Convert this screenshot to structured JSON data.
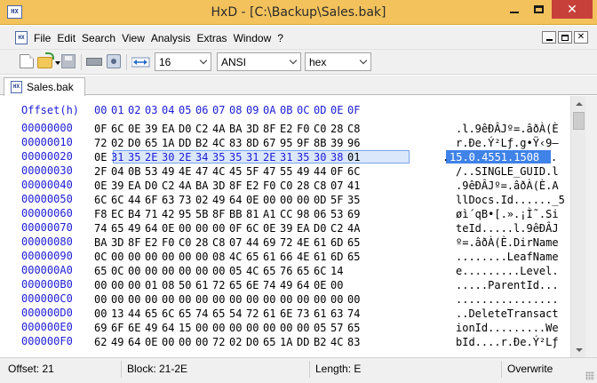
{
  "window": {
    "title": "HxD - [C:\\Backup\\Sales.bak]",
    "app_icon_text": "HX",
    "minimize_icon": "minimize-icon",
    "maximize_icon": "maximize-icon",
    "close_icon": "close-icon",
    "close_glyph": "✕",
    "accent_color": "#f3c25c",
    "close_color": "#c7403a"
  },
  "menu": {
    "doc_icon_text": "HX",
    "items": [
      "File",
      "Edit",
      "Search",
      "View",
      "Analysis",
      "Extras",
      "Window",
      "?"
    ],
    "mdi_close_glyph": "✕"
  },
  "toolbar": {
    "icons": [
      "new-file-icon",
      "open-folder-icon",
      "save-icon",
      "open-ram-icon",
      "open-disk-icon",
      "bytes-per-row-icon"
    ],
    "bytes_per_row_arrow": "↔",
    "bytes_per_row": "16",
    "charset": "ANSI",
    "offset_base": "hex"
  },
  "tab": {
    "icon_text": "HX",
    "label": "Sales.bak"
  },
  "editor": {
    "header_label": "Offset(h)",
    "columns": [
      "00",
      "01",
      "02",
      "03",
      "04",
      "05",
      "06",
      "07",
      "08",
      "09",
      "0A",
      "0B",
      "0C",
      "0D",
      "0E",
      "0F"
    ],
    "offset_color": "#1c1cd6",
    "selection": {
      "start_offset": "00000021",
      "end_offset": "0000002E",
      "text": "15.0.4551.1508",
      "highlight_color": "#3f82e8"
    },
    "rows": [
      {
        "offset": "00000000",
        "bytes": [
          "0F",
          "6C",
          "0E",
          "39",
          "EA",
          "D0",
          "C2",
          "4A",
          "BA",
          "3D",
          "8F",
          "E2",
          "F0",
          "C0",
          "28",
          "C8"
        ],
        "text": ".l.9êÐÂJº=.âðÀ(È"
      },
      {
        "offset": "00000010",
        "bytes": [
          "72",
          "02",
          "D0",
          "65",
          "1A",
          "DD",
          "B2",
          "4C",
          "83",
          "8D",
          "67",
          "95",
          "9F",
          "8B",
          "39",
          "96"
        ],
        "text": "r.Ðe.Ý²Lƒ.g•Ÿ‹9–"
      },
      {
        "offset": "00000020",
        "bytes": [
          "0E",
          "31",
          "35",
          "2E",
          "30",
          "2E",
          "34",
          "35",
          "35",
          "31",
          "2E",
          "31",
          "35",
          "30",
          "38",
          "01"
        ],
        "text_head": ".",
        "text_sel": "15.0.4551.1508",
        "text_tail": "."
      },
      {
        "offset": "00000030",
        "bytes": [
          "2F",
          "04",
          "0B",
          "53",
          "49",
          "4E",
          "47",
          "4C",
          "45",
          "5F",
          "47",
          "55",
          "49",
          "44",
          "0F",
          "6C"
        ],
        "text": "/..SINGLE_GUID.l"
      },
      {
        "offset": "00000040",
        "bytes": [
          "0E",
          "39",
          "EA",
          "D0",
          "C2",
          "4A",
          "BA",
          "3D",
          "8F",
          "E2",
          "F0",
          "C0",
          "28",
          "C8",
          "07",
          "41"
        ],
        "text": ".9êÐÂJº=.âðÀ(È.A"
      },
      {
        "offset": "00000050",
        "bytes": [
          "6C",
          "6C",
          "44",
          "6F",
          "63",
          "73",
          "02",
          "49",
          "64",
          "0E",
          "00",
          "00",
          "00",
          "0D",
          "5F",
          "35"
        ],
        "text": "llDocs.Id......_5"
      },
      {
        "offset": "00000060",
        "bytes": [
          "F8",
          "EC",
          "B4",
          "71",
          "42",
          "95",
          "5B",
          "8F",
          "BB",
          "81",
          "A1",
          "CC",
          "98",
          "06",
          "53",
          "69"
        ],
        "text": "øì´qB•[.».¡Ì˜.Si"
      },
      {
        "offset": "00000070",
        "bytes": [
          "74",
          "65",
          "49",
          "64",
          "0E",
          "00",
          "00",
          "00",
          "0F",
          "6C",
          "0E",
          "39",
          "EA",
          "D0",
          "C2",
          "4A"
        ],
        "text": "teId.....l.9êÐÂJ"
      },
      {
        "offset": "00000080",
        "bytes": [
          "BA",
          "3D",
          "8F",
          "E2",
          "F0",
          "C0",
          "28",
          "C8",
          "07",
          "44",
          "69",
          "72",
          "4E",
          "61",
          "6D",
          "65"
        ],
        "text": "º=.âðÀ(È.DirName"
      },
      {
        "offset": "00000090",
        "bytes": [
          "0C",
          "00",
          "00",
          "00",
          "00",
          "00",
          "00",
          "08",
          "4C",
          "65",
          "61",
          "66",
          "4E",
          "61",
          "6D",
          "65"
        ],
        "text": "........LeafName"
      },
      {
        "offset": "000000A0",
        "bytes": [
          "65",
          "0C",
          "00",
          "00",
          "00",
          "00",
          "00",
          "00",
          "05",
          "4C",
          "65",
          "76",
          "65",
          "6C",
          "14"
        ],
        "text": "e.........Level."
      },
      {
        "offset": "000000B0",
        "bytes": [
          "00",
          "00",
          "00",
          "01",
          "08",
          "50",
          "61",
          "72",
          "65",
          "6E",
          "74",
          "49",
          "64",
          "0E",
          "00"
        ],
        "text": ".....ParentId..."
      },
      {
        "offset": "000000C0",
        "bytes": [
          "00",
          "00",
          "00",
          "00",
          "00",
          "00",
          "00",
          "00",
          "00",
          "00",
          "00",
          "00",
          "00",
          "00",
          "00",
          "00"
        ],
        "text": "................"
      },
      {
        "offset": "000000D0",
        "bytes": [
          "00",
          "13",
          "44",
          "65",
          "6C",
          "65",
          "74",
          "65",
          "54",
          "72",
          "61",
          "6E",
          "73",
          "61",
          "63",
          "74"
        ],
        "text": "..DeleteTransact"
      },
      {
        "offset": "000000E0",
        "bytes": [
          "69",
          "6F",
          "6E",
          "49",
          "64",
          "15",
          "00",
          "00",
          "00",
          "00",
          "00",
          "00",
          "00",
          "05",
          "57",
          "65"
        ],
        "text": "ionId.........We"
      },
      {
        "offset": "000000F0",
        "bytes": [
          "62",
          "49",
          "64",
          "0E",
          "00",
          "00",
          "00",
          "72",
          "02",
          "D0",
          "65",
          "1A",
          "DD",
          "B2",
          "4C",
          "83"
        ],
        "text": "bId....r.Ðe.Ý²Lƒ"
      }
    ]
  },
  "status": {
    "offset": "Offset: 21",
    "block": "Block: 21-2E",
    "length": "Length: E",
    "mode": "Overwrite"
  }
}
